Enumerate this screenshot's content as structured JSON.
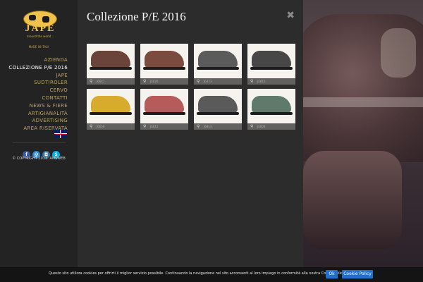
{
  "brand": {
    "name": "JAPE",
    "tagline": "around the world...",
    "made_in": "MADE IN ITALY"
  },
  "nav": {
    "items": [
      {
        "label": "AZIENDA",
        "active": false
      },
      {
        "label": "COLLEZIONE P/E 2016",
        "active": true
      },
      {
        "label": "JAPE",
        "active": false
      },
      {
        "label": "SUDTIROLER",
        "active": false
      },
      {
        "label": "CERVO",
        "active": false
      },
      {
        "label": "CONTATTI",
        "active": false
      },
      {
        "label": "NEWS & FIERE",
        "active": false
      },
      {
        "label": "ARTIGIANALITÀ",
        "active": false
      },
      {
        "label": "ADVERTISING",
        "active": false
      },
      {
        "label": "AREA RISERVATA",
        "active": false
      }
    ]
  },
  "language_flag": "english-flag-icon",
  "socials": [
    {
      "name": "facebook-icon",
      "glyph": "f",
      "color": "#3b5998"
    },
    {
      "name": "email-icon",
      "glyph": "@",
      "color": "#2a8ad4"
    },
    {
      "name": "instagram-icon",
      "glyph": "◘",
      "color": "#3f729b"
    },
    {
      "name": "skype-icon",
      "glyph": "S",
      "color": "#00aff0"
    }
  ],
  "copyright": "© COPYRIGHT 2013. AMSWEB",
  "page": {
    "title": "Collezione P/E 2016",
    "close_glyph": "✖"
  },
  "gallery": [
    {
      "code": "J6641",
      "color": "#6a4438"
    },
    {
      "code": "J6836",
      "color": "#7a4b3e"
    },
    {
      "code": "J6373",
      "color": "#5b5b5b"
    },
    {
      "code": "J6816",
      "color": "#474747"
    },
    {
      "code": "J6656",
      "color": "#d8aa2d"
    },
    {
      "code": "J6811",
      "color": "#b65a5a"
    },
    {
      "code": "J6813",
      "color": "#5a5a5a"
    },
    {
      "code": "J6808",
      "color": "#5f7a6a"
    }
  ],
  "cookie": {
    "text": "Questo sito utilizza cookies per offrirti il miglior servizio possibile. Continuando la navigazione nel sito acconsenti al loro impiego in conformità alla nostra Cookie Policy",
    "ok_label": "Ok",
    "policy_label": "Cookie Policy"
  },
  "colors": {
    "accent": "#b9a36a",
    "gold": "#f0c648",
    "button": "#1f6fcf"
  }
}
